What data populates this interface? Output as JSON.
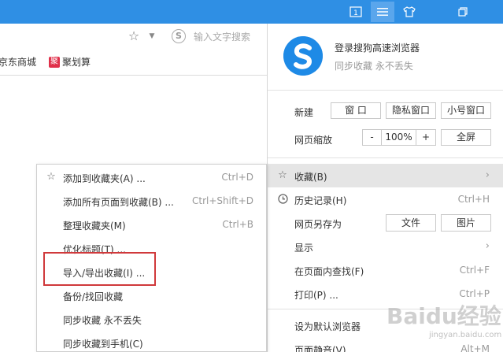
{
  "titlebar": {
    "page_counter": "1",
    "buttons": [
      "page-counter",
      "main-menu",
      "skin",
      "restore"
    ]
  },
  "toolbar": {
    "search_placeholder": "输入文字搜索",
    "search_logo_letter": "S"
  },
  "bookmarks": {
    "items": [
      {
        "label": "京东商城"
      },
      {
        "label": "聚划算",
        "icon_text": "聚"
      }
    ]
  },
  "menu": {
    "profile_title": "登录搜狗高速浏览器",
    "profile_subtitle": "同步收藏 永不丢失",
    "new_label": "新建",
    "new_window": "窗 口",
    "private_window": "隐私窗口",
    "small_window": "小号窗口",
    "zoom_label": "网页缩放",
    "zoom_minus": "-",
    "zoom_value": "100%",
    "zoom_plus": "+",
    "fullscreen": "全屏",
    "favorites": "收藏(B)",
    "history": "历史记录(H)",
    "history_shortcut": "Ctrl+H",
    "save_as": "网页另存为",
    "save_file": "文件",
    "save_image": "图片",
    "display": "显示",
    "find_in_page": "在页面内查找(F)",
    "find_shortcut": "Ctrl+F",
    "print": "打印(P) ...",
    "print_shortcut": "Ctrl+P",
    "set_default": "设为默认浏览器",
    "mute_page": "页面静音(V)",
    "mute_shortcut": "Alt+M"
  },
  "submenu": {
    "items": [
      {
        "label": "添加到收藏夹(A) ...",
        "shortcut": "Ctrl+D",
        "icon": "star-icon"
      },
      {
        "label": "添加所有页面到收藏(B) ...",
        "shortcut": "Ctrl+Shift+D"
      },
      {
        "label": "整理收藏夹(M)",
        "shortcut": "Ctrl+B"
      },
      {
        "label": "优化标题(T) ...",
        "shortcut": ""
      },
      {
        "label": "导入/导出收藏(I) ...",
        "shortcut": ""
      },
      {
        "label": "备份/找回收藏",
        "shortcut": ""
      },
      {
        "label": "同步收藏 永不丢失",
        "shortcut": ""
      },
      {
        "label": "同步收藏到手机(C)",
        "shortcut": ""
      }
    ]
  },
  "watermark": {
    "text": "Baidu经验",
    "url": "jingyan.baidu.com"
  },
  "colors": {
    "titlebar": "#2f8fe4",
    "highlight": "#d0393b",
    "hover_row": "#e5e5e5"
  }
}
